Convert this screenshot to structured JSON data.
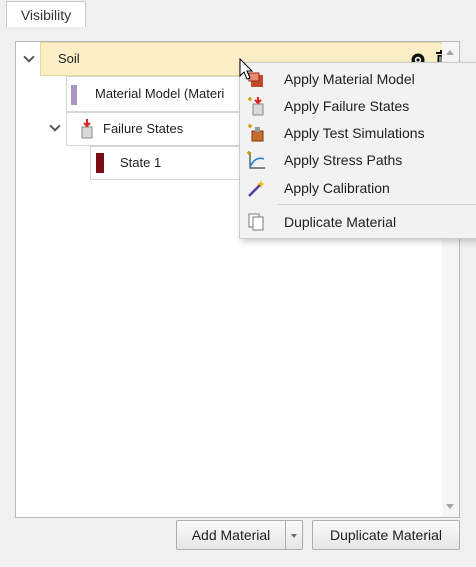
{
  "tab": {
    "label": "Visibility"
  },
  "tree": {
    "soil": {
      "label": "Soil",
      "highlight_color": "#fcefc6"
    },
    "material_model": {
      "label": "Material Model (Materi",
      "color": "#a996c6"
    },
    "failure_states": {
      "label": "Failure States"
    },
    "state1": {
      "label": "State 1",
      "color": "#7a0c14"
    }
  },
  "context_menu": {
    "items": [
      {
        "label": "Apply Material Model",
        "icon": "material-model-icon"
      },
      {
        "label": "Apply Failure States",
        "icon": "failure-states-icon"
      },
      {
        "label": "Apply Test Simulations",
        "icon": "test-simulations-icon"
      },
      {
        "label": "Apply Stress Paths",
        "icon": "stress-paths-icon"
      },
      {
        "label": "Apply Calibration",
        "icon": "calibration-wand-icon"
      },
      {
        "label": "Duplicate Material",
        "icon": "duplicate-icon"
      }
    ]
  },
  "buttons": {
    "add_material": "Add Material",
    "duplicate_material": "Duplicate Material"
  }
}
